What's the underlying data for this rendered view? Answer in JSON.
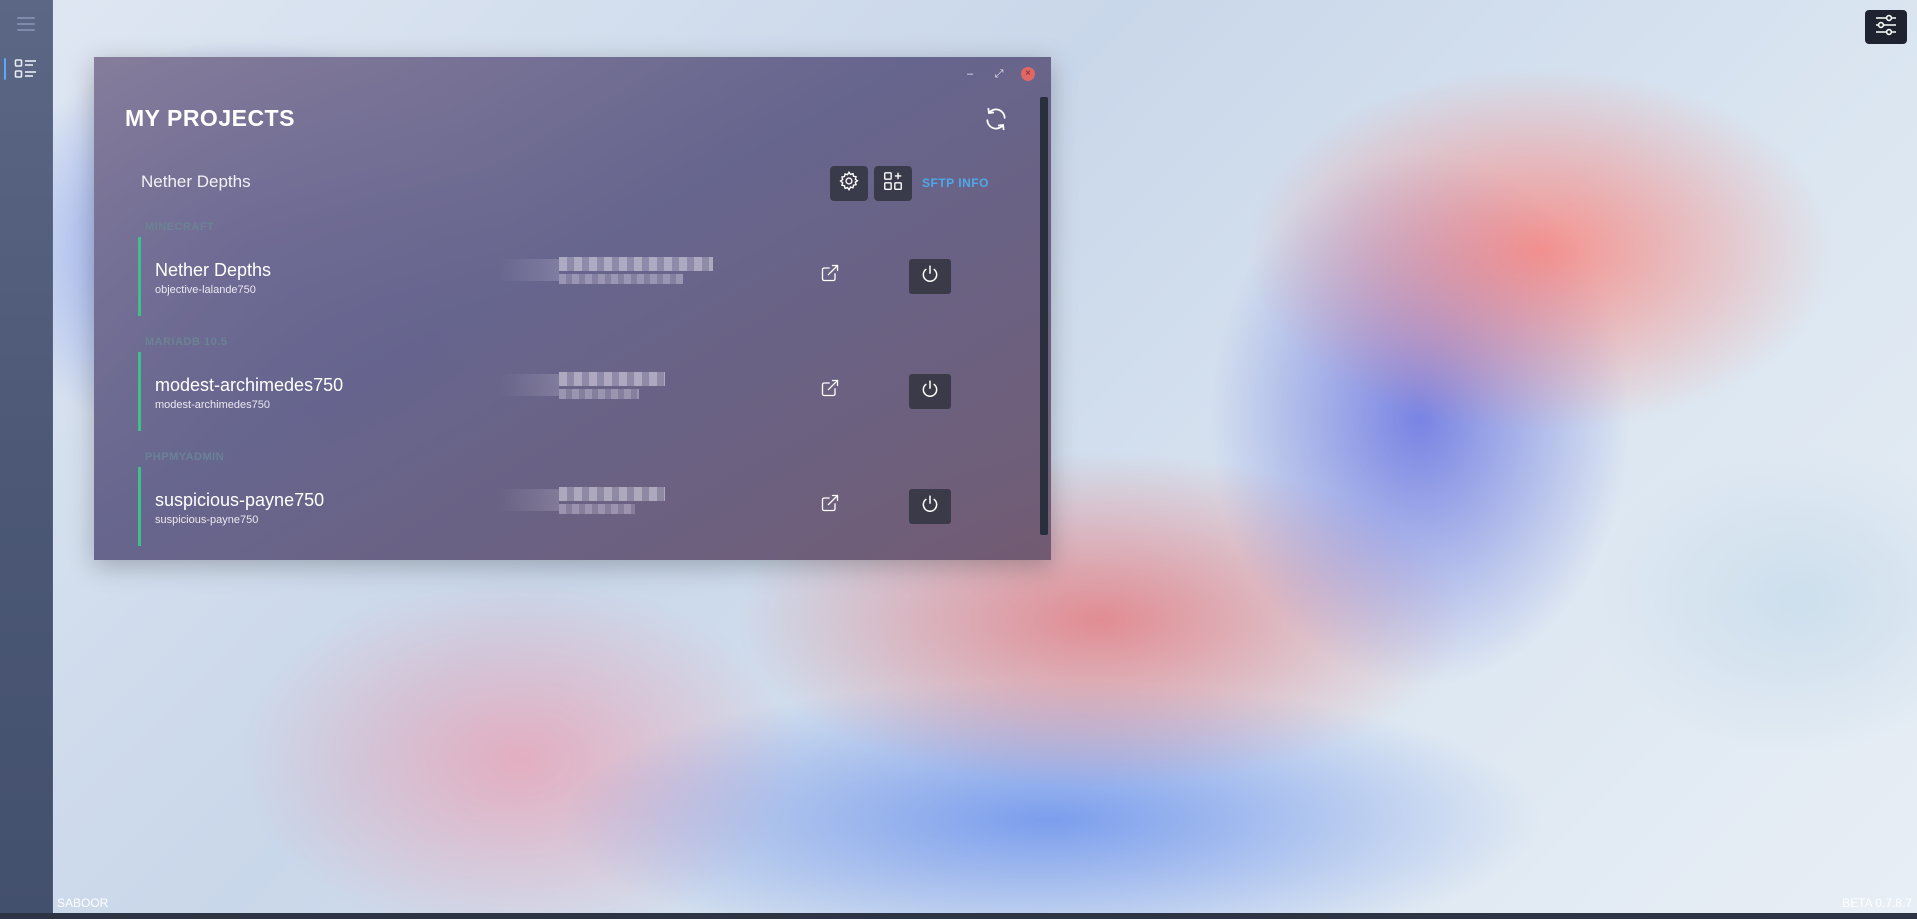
{
  "window": {
    "title": "MY PROJECTS",
    "controls": {
      "minimize": "–",
      "restore": "⤢",
      "close": "×"
    }
  },
  "project": {
    "name": "Nether Depths",
    "sftp_label": "SFTP INFO"
  },
  "services": [
    {
      "category": "MINECRAFT",
      "name": "Nether Depths",
      "id": "objective-lalande750"
    },
    {
      "category": "MARIADB 10.5",
      "name": "modest-archimedes750",
      "id": "modest-archimedes750"
    },
    {
      "category": "PHPMYADMIN",
      "name": "suspicious-payne750",
      "id": "suspicious-payne750"
    }
  ],
  "footer": {
    "user": "SABOOR",
    "version": "BETA 0.7.8.7"
  },
  "colors": {
    "accent": "#4fa8e9",
    "status_bar": "#3fbf8a",
    "close": "#e06767"
  },
  "icons": [
    "menu-icon",
    "projects-list-icon",
    "settings-sliders-icon",
    "refresh-icon",
    "gear-icon",
    "add-widget-icon",
    "external-link-icon",
    "power-icon"
  ]
}
